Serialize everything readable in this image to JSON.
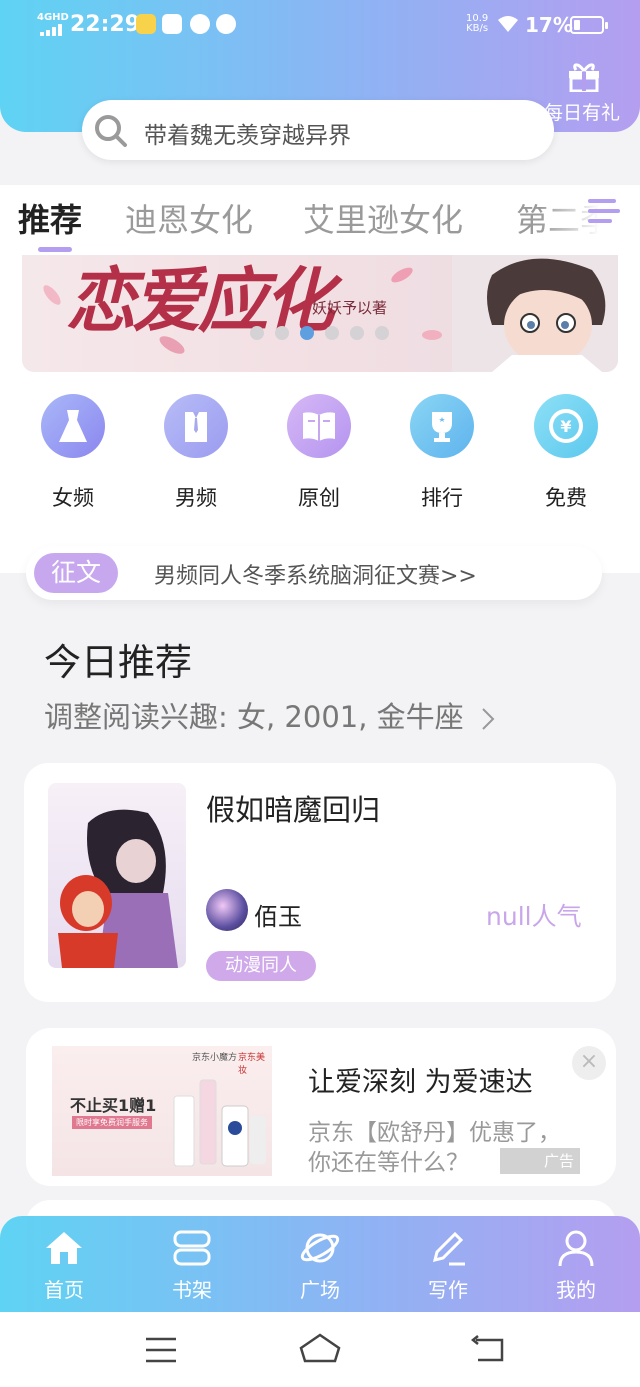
{
  "status_bar": {
    "network": "4GHD",
    "time": "22:29",
    "speed_value": "10.9",
    "speed_unit": "KB/s",
    "battery_percent": "17%"
  },
  "header": {
    "gift_label": "每日有礼"
  },
  "search": {
    "placeholder": "带着魏无羡穿越异界"
  },
  "tabs": [
    {
      "label": "推荐"
    },
    {
      "label": "迪恩女化"
    },
    {
      "label": "艾里逊女化"
    },
    {
      "label": "第二季"
    }
  ],
  "banner": {
    "title": "恋爱应化",
    "author": "妖妖予以著",
    "slide_count": 6,
    "active_slide_index": 2
  },
  "categories": [
    {
      "label": "女频",
      "icon": "dress-icon"
    },
    {
      "label": "男频",
      "icon": "shirt-icon"
    },
    {
      "label": "原创",
      "icon": "book-icon"
    },
    {
      "label": "排行",
      "icon": "trophy-icon"
    },
    {
      "label": "免费",
      "icon": "yuan-coin-icon"
    }
  ],
  "notice": {
    "badge": "征文",
    "text": "男频同人冬季系统脑洞征文赛>>"
  },
  "today": {
    "title": "今日推荐",
    "interest_line": "调整阅读兴趣: 女, 2001, 金牛座"
  },
  "book": {
    "title": "假如暗魔回归",
    "author": "佰玉",
    "popularity": "null人气",
    "tag": "动漫同人"
  },
  "ad": {
    "image_brand": "京东小魔方",
    "image_brand2": "京东美妆",
    "image_text": "不止买1赠1",
    "image_subtext": "限时享免费润手服务",
    "title": "让爱深刻 为爱速达",
    "description": "京东【欧舒丹】优惠了，你还在等什么？",
    "close": "×",
    "badge": "广告"
  },
  "bottom_nav": [
    {
      "label": "首页",
      "icon": "home-icon"
    },
    {
      "label": "书架",
      "icon": "bookshelf-icon"
    },
    {
      "label": "广场",
      "icon": "planet-icon"
    },
    {
      "label": "写作",
      "icon": "pen-icon"
    },
    {
      "label": "我的",
      "icon": "user-icon"
    }
  ],
  "colors": {
    "gradient_start": "#5fd3f3",
    "gradient_end": "#b49ef0",
    "accent_purple": "#c7a8ef",
    "dot_active": "#5e9fe0"
  }
}
